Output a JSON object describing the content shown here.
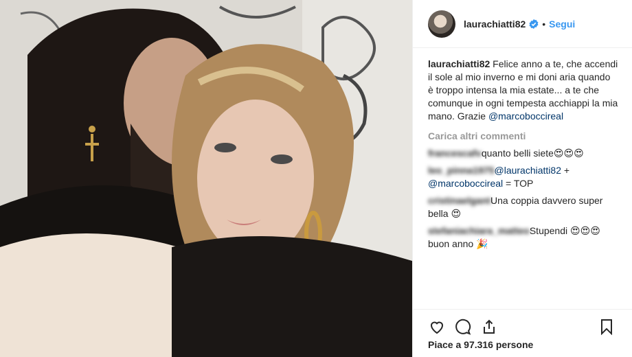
{
  "post": {
    "username": "laurachiatti82",
    "follow_label": "Segui",
    "separator": "•",
    "caption_user": "laurachiatti82",
    "caption_text": "Felice anno a te, che accendi il sole al mio inverno e mi doni aria quando è troppo intensa la mia estate... a te che comunque in ogni tempesta acchiappi la mia mano. Grazie",
    "caption_mention": "@marcoboccireal",
    "load_more": "Carica altri commenti"
  },
  "comments": [
    {
      "user": "francescafv",
      "text": "quanto belli siete😍😍😍"
    },
    {
      "user": "leo_pinna1975",
      "mention": "@laurachiatti82",
      "text": " + ",
      "mention2": "@marcoboccireal",
      "text2": " = TOP"
    },
    {
      "user": "cristinaelgant",
      "text": "Una coppia davvero super bella 😍"
    },
    {
      "user": "stefaniachiara_matteo",
      "text": "Stupendi 😍😍😍 buon anno 🎉"
    }
  ],
  "likes": "Piace a 97.316 persone",
  "icons": [
    "heart-icon",
    "comment-icon",
    "share-icon",
    "bookmark-icon",
    "verified-badge-icon"
  ],
  "colors": {
    "accent": "#3897f0",
    "mention": "#003569",
    "muted": "#999999"
  }
}
